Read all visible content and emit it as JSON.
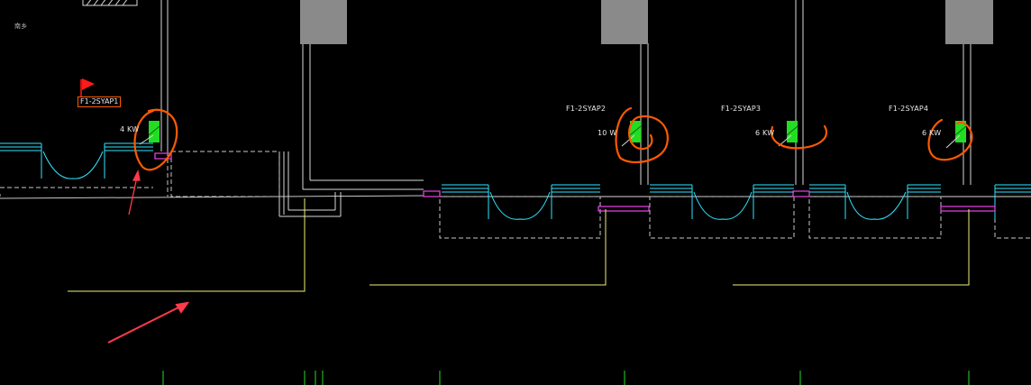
{
  "drawing": {
    "corner_label": "南乡",
    "panels": [
      {
        "id": "F1-2SYAP1",
        "power": "4 KW"
      },
      {
        "id": "F1-2SYAP2",
        "power": "10 W"
      },
      {
        "id": "F1-2SYAP3",
        "power": "6 KW"
      },
      {
        "id": "F1-2SYAP4",
        "power": "6 KW"
      }
    ]
  },
  "colors": {
    "background": "#000000",
    "wall": "#d8d8d8",
    "column_fill": "#8a8a8a",
    "window": "#2ee6ff",
    "door_swing": "#2ee6ff",
    "panel_fill": "#22dd22",
    "magenta": "#e040e0",
    "cable": "#f0f07a",
    "dashed": "#c8c8c8",
    "annotation": "#ff5a00",
    "arrow": "#ff3b4a",
    "flag": "#ff1a1a",
    "tick": "#22dd22"
  },
  "icons": {
    "flag": "red-flag-icon",
    "arrow": "annotation-arrow-icon",
    "panel": "distribution-panel-icon"
  }
}
